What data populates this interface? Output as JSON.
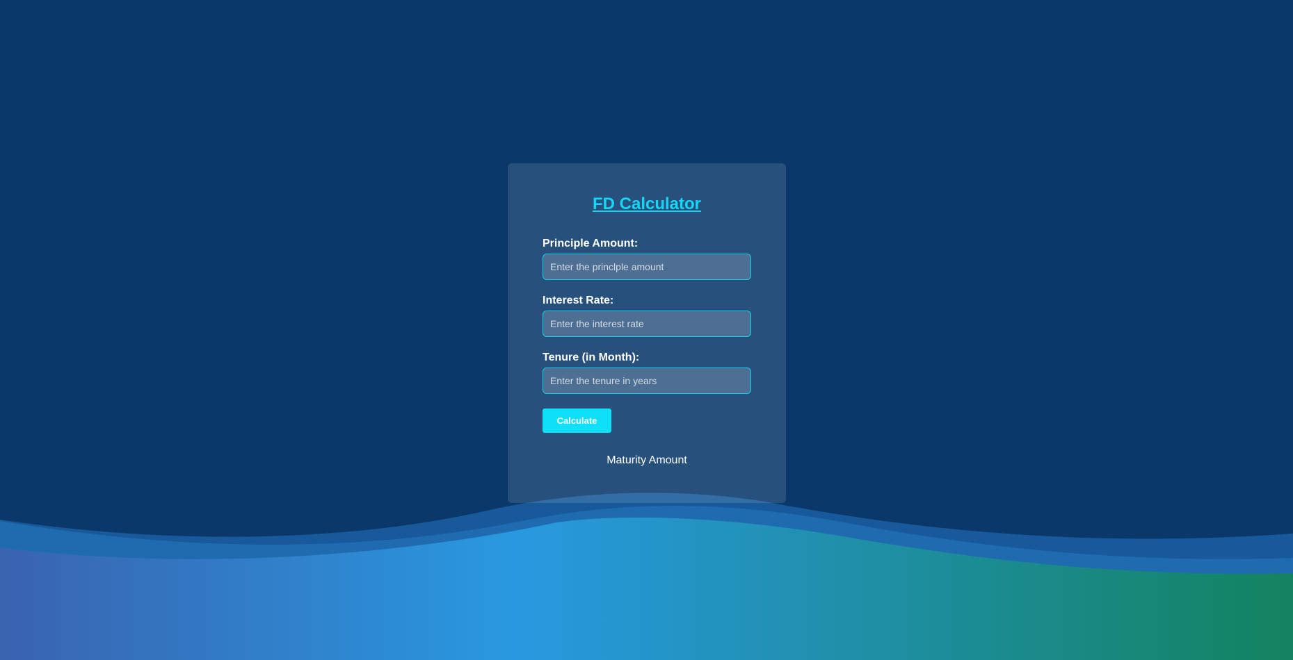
{
  "form": {
    "title": "FD Calculator",
    "fields": [
      {
        "label": "Principle Amount:",
        "value": "",
        "placeholder": "Enter the princlple amount"
      },
      {
        "label": "Interest Rate:",
        "value": "",
        "placeholder": "Enter the interest rate"
      },
      {
        "label": "Tenure (in Month):",
        "value": "",
        "placeholder": "Enter the tenure in years"
      }
    ],
    "calculate_label": "Calculate",
    "result_label": "Maturity Amount"
  },
  "colors": {
    "background": "#0a386a",
    "accent": "#15d6f4",
    "button": "#0fe0f9",
    "wave_left": "#3a63b0",
    "wave_mid": "#2899e0",
    "wave_right": "#13835f"
  }
}
